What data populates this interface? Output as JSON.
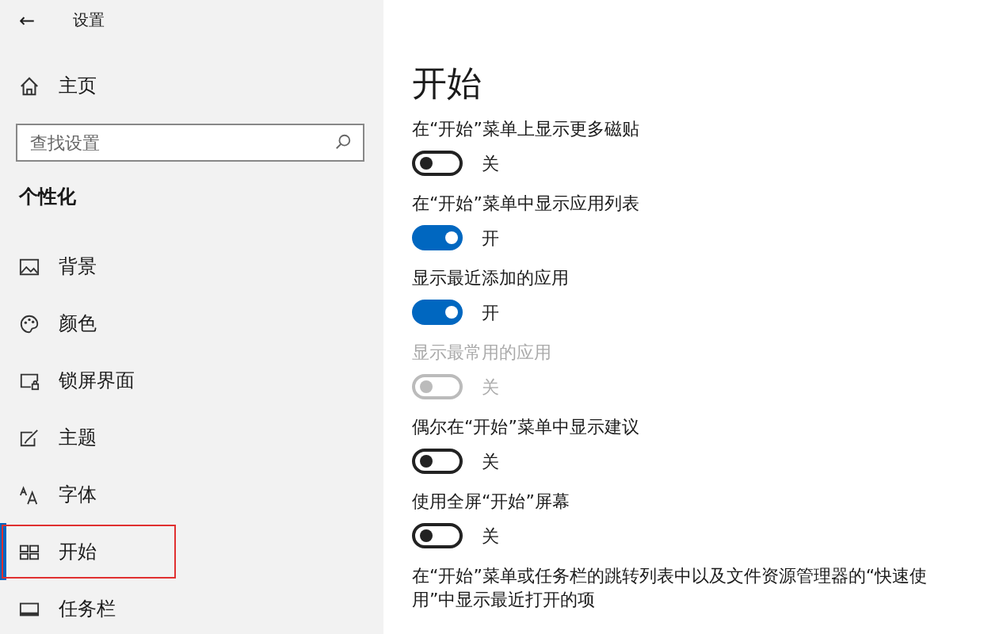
{
  "window": {
    "back": "←",
    "title": "设置"
  },
  "sidebar": {
    "home": "主页",
    "search": {
      "placeholder": "查找设置"
    },
    "section": "个性化",
    "items": [
      {
        "label": "背景",
        "selected": false,
        "annotated": false
      },
      {
        "label": "颜色",
        "selected": false,
        "annotated": false
      },
      {
        "label": "锁屏界面",
        "selected": false,
        "annotated": false
      },
      {
        "label": "主题",
        "selected": false,
        "annotated": false
      },
      {
        "label": "字体",
        "selected": false,
        "annotated": false
      },
      {
        "label": "开始",
        "selected": true,
        "annotated": true
      },
      {
        "label": "任务栏",
        "selected": false,
        "annotated": false
      }
    ]
  },
  "content": {
    "title": "开始",
    "settings": [
      {
        "kind": "toggle",
        "label": "在“开始”菜单上显示更多磁贴",
        "on": false,
        "disabled": false,
        "state_text": "关"
      },
      {
        "kind": "toggle",
        "label": "在“开始”菜单中显示应用列表",
        "on": true,
        "disabled": false,
        "state_text": "开"
      },
      {
        "kind": "toggle",
        "label": "显示最近添加的应用",
        "on": true,
        "disabled": false,
        "state_text": "开"
      },
      {
        "kind": "toggle",
        "label": "显示最常用的应用",
        "on": false,
        "disabled": true,
        "state_text": "关"
      },
      {
        "kind": "toggle",
        "label": "偶尔在“开始”菜单中显示建议",
        "on": false,
        "disabled": false,
        "state_text": "关"
      },
      {
        "kind": "toggle",
        "label": "使用全屏“开始”屏幕",
        "on": false,
        "disabled": false,
        "state_text": "关"
      },
      {
        "kind": "text",
        "label": "在“开始”菜单或任务栏的跳转列表中以及文件资源管理器的“快速使用”中显示最近打开的项"
      }
    ]
  }
}
